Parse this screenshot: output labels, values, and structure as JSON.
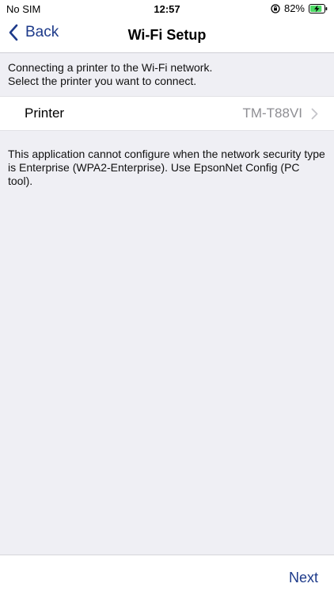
{
  "status_bar": {
    "carrier": "No SIM",
    "time": "12:57",
    "battery": "82%"
  },
  "nav": {
    "back_label": "Back",
    "title": "Wi-Fi Setup"
  },
  "intro": {
    "line1": "Connecting a printer to the Wi-Fi network.",
    "line2": "Select the printer you want to connect."
  },
  "printer_row": {
    "label": "Printer",
    "value": "TM-T88VI"
  },
  "notice": {
    "text": "This application cannot configure when the network security type is Enterprise (WPA2-Enterprise). Use EpsonNet Config (PC tool)."
  },
  "toolbar": {
    "next_label": "Next"
  },
  "colors": {
    "accent": "#1d3a8a",
    "background": "#efeff4",
    "battery_green": "#4cd964"
  },
  "icons": {
    "back": "chevron-left-icon",
    "row_disclosure": "chevron-right-icon",
    "orientation_lock": "orientation-lock-icon",
    "battery": "battery-charging-icon"
  }
}
